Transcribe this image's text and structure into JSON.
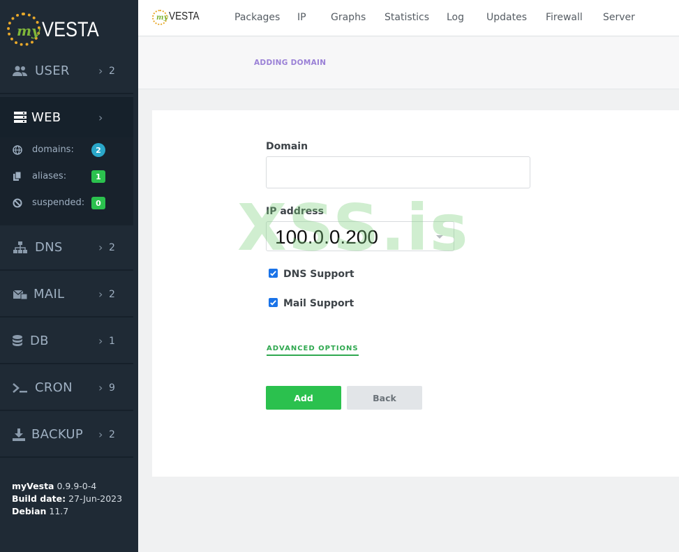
{
  "sidebar": {
    "logo": {
      "prefix": "my",
      "name": "VESTA"
    },
    "items": [
      {
        "key": "user",
        "label": "USER",
        "icon": "users-icon",
        "count": "2"
      },
      {
        "key": "web",
        "label": "WEB",
        "icon": "server-icon",
        "count": "",
        "active": true
      },
      {
        "key": "dns",
        "label": "DNS",
        "icon": "network-icon",
        "count": "2"
      },
      {
        "key": "mail",
        "label": "MAIL",
        "icon": "mail-icon",
        "count": "2"
      },
      {
        "key": "db",
        "label": "DB",
        "icon": "database-icon",
        "count": "1"
      },
      {
        "key": "cron",
        "label": "CRON",
        "icon": "terminal-icon",
        "count": "9"
      },
      {
        "key": "backup",
        "label": "BACKUP",
        "icon": "download-icon",
        "count": "2"
      }
    ],
    "web_sub": [
      {
        "label": "domains:",
        "icon": "globe-icon",
        "badge": "2",
        "badge_color": "#2aa7c9",
        "badge_round": true
      },
      {
        "label": "aliases:",
        "icon": "copy-icon",
        "badge": "1",
        "badge_color": "#2bc14e"
      },
      {
        "label": "suspended:",
        "icon": "ban-icon",
        "badge": "0",
        "badge_color": "#2bc14e"
      }
    ],
    "footer": {
      "product_label": "myVesta",
      "product_version": "0.9.9-0-4",
      "build_label": "Build date:",
      "build_date": "27-Jun-2023",
      "os_label": "Debian",
      "os_version": "11.7"
    }
  },
  "topbar": {
    "logo": {
      "prefix": "my",
      "name": "VESTA"
    },
    "nav": [
      "Packages",
      "IP",
      "Graphs",
      "Statistics",
      "Log",
      "Updates",
      "Firewall",
      "Server"
    ]
  },
  "page": {
    "title": "ADDING DOMAIN"
  },
  "form": {
    "domain_label": "Domain",
    "domain_value": "",
    "ip_label": "IP address",
    "ip_value": "100.0.0.200",
    "dns_label": "DNS Support",
    "dns_checked": true,
    "mail_label": "Mail Support",
    "mail_checked": true,
    "advanced_label": "ADVANCED OPTIONS",
    "add_label": "Add",
    "back_label": "Back"
  },
  "watermark": "XSS.is",
  "colors": {
    "sidebar_bg": "#1f2a35",
    "accent_green": "#2bc14e",
    "title_purple": "#9a80d6",
    "checkbox_blue": "#1a73e8"
  }
}
